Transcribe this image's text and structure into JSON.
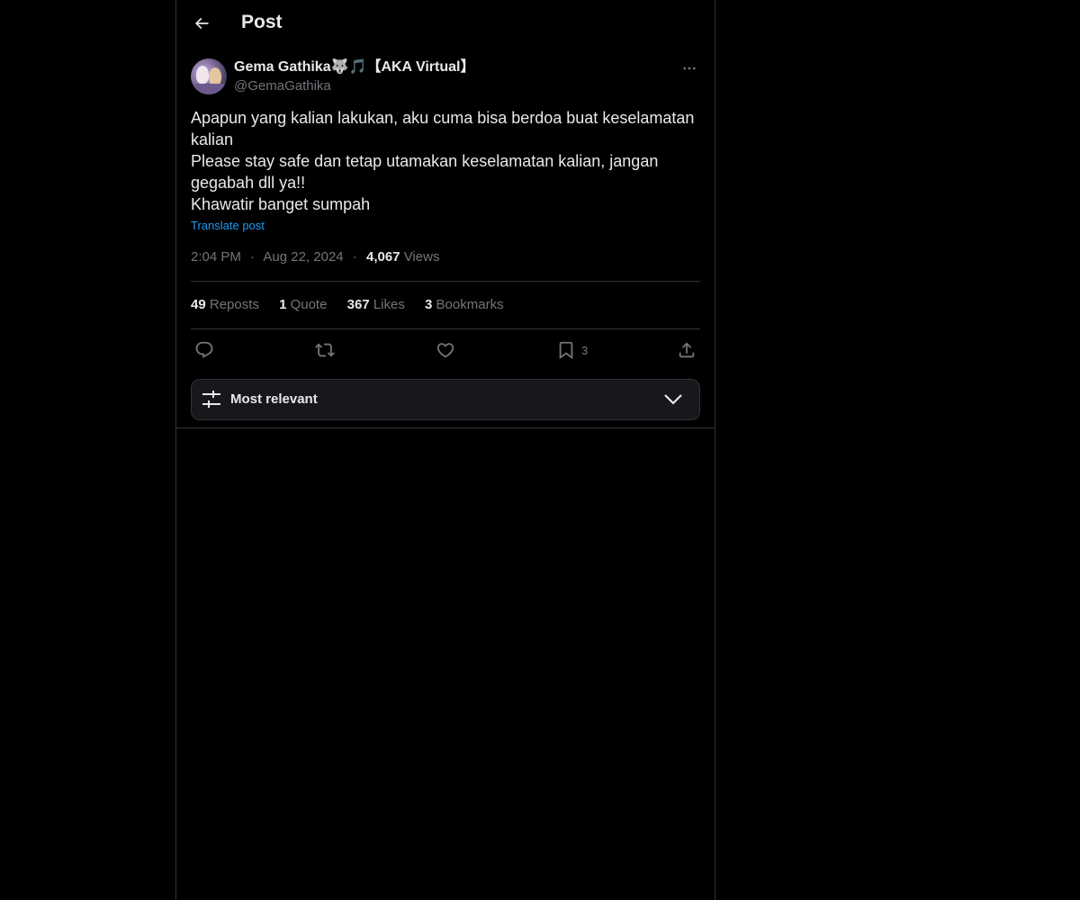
{
  "header": {
    "title": "Post"
  },
  "post": {
    "author": {
      "display_name": "Gema Gathika🐺🎵【AKA Virtual】",
      "handle": "@GemaGathika"
    },
    "text_lines": [
      "Apapun yang kalian lakukan, aku cuma bisa berdoa buat keselamatan kalian",
      "Please stay safe dan tetap utamakan keselamatan kalian, jangan gegabah dll ya!!",
      "Khawatir banget sumpah"
    ],
    "translate_label": "Translate post",
    "time": "2:04 PM",
    "date": "Aug 22, 2024",
    "separator": "·",
    "views_count": "4,067",
    "views_label": "Views"
  },
  "stats": {
    "reposts_count": "49",
    "reposts_label": "Reposts",
    "quotes_count": "1",
    "quotes_label": "Quote",
    "likes_count": "367",
    "likes_label": "Likes",
    "bookmarks_count": "3",
    "bookmarks_label": "Bookmarks"
  },
  "actions": {
    "bookmark_count": "3",
    "icons": [
      "reply-icon",
      "repost-icon",
      "like-icon",
      "bookmark-icon",
      "share-icon"
    ]
  },
  "sort": {
    "label": "Most relevant"
  },
  "colors": {
    "background": "#000000",
    "text_primary": "#e7e9ea",
    "text_secondary": "#71767b",
    "accent": "#1d9bf0",
    "border": "#2f3336",
    "sort_box_bg": "#16181c"
  }
}
